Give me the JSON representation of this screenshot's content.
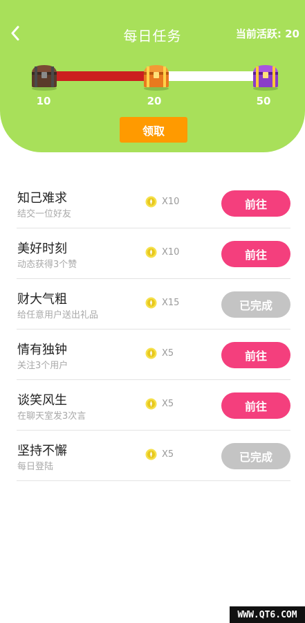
{
  "header": {
    "title": "每日任务",
    "activity": "当前活跃: 20",
    "progress_fraction": 0.5,
    "milestones": [
      "10",
      "20",
      "50"
    ],
    "claim_label": "领取"
  },
  "tasks": [
    {
      "name": "知己难求",
      "desc": "结交一位好友",
      "reward": "X10",
      "action": "前往",
      "status": "go"
    },
    {
      "name": "美好时刻",
      "desc": "动态获得3个赞",
      "reward": "X10",
      "action": "前往",
      "status": "go"
    },
    {
      "name": "财大气粗",
      "desc": "给任意用户送出礼品",
      "reward": "X15",
      "action": "已完成",
      "status": "done"
    },
    {
      "name": "情有独钟",
      "desc": "关注3个用户",
      "reward": "X5",
      "action": "前往",
      "status": "go"
    },
    {
      "name": "谈笑风生",
      "desc": "在聊天室发3次言",
      "reward": "X5",
      "action": "前往",
      "status": "go"
    },
    {
      "name": "坚持不懈",
      "desc": "每日登陆",
      "reward": "X5",
      "action": "已完成",
      "status": "done"
    }
  ],
  "watermark": "WWW.QT6.COM",
  "colors": {
    "header_bg": "#a8e05a",
    "progress_fill": "#cc1f1f",
    "claim_button": "#ff9a00",
    "go_button": "#f43f7d",
    "done_button": "#c4c4c4"
  },
  "icons": {
    "back": "chevron-left-icon",
    "chest": "treasure-chest-icon",
    "coin": "coin-icon"
  }
}
